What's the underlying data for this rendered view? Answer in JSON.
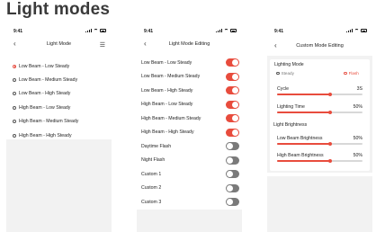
{
  "page_title": "Light modes",
  "status_time": "9:41",
  "screen1": {
    "title": "Light Mode",
    "items": [
      {
        "label": "Low Beam - Low Steady",
        "selected": true
      },
      {
        "label": "Low Beam - Medium Steady",
        "selected": false
      },
      {
        "label": "Low Beam - High Steady",
        "selected": false
      },
      {
        "label": "High Beam - Low Steady",
        "selected": false
      },
      {
        "label": "High Beam - Medium Steady",
        "selected": false
      },
      {
        "label": "High Beam - High Steady",
        "selected": false
      }
    ]
  },
  "screen2": {
    "title": "Light Mode Editing",
    "items": [
      {
        "label": "Low Beam - Low Steady",
        "on": true
      },
      {
        "label": "Low Beam - Medium Steady",
        "on": true
      },
      {
        "label": "Low Beam - High Steady",
        "on": true
      },
      {
        "label": "High Beam - Low Steady",
        "on": true
      },
      {
        "label": "High Beam - Medium Steady",
        "on": true
      },
      {
        "label": "High Beam - High Steady",
        "on": true
      },
      {
        "label": "Daytime Flash",
        "on": false
      },
      {
        "label": "Night Flash",
        "on": false
      },
      {
        "label": "Custom 1",
        "on": false
      },
      {
        "label": "Custom 2",
        "on": false
      },
      {
        "label": "Custom 3",
        "on": false
      }
    ]
  },
  "screen3": {
    "title": "Custom Mode Editing",
    "lighting_mode_label": "Lighting Mode",
    "mode_options": [
      {
        "label": "Steady",
        "selected": false
      },
      {
        "label": "Flash",
        "selected": true
      }
    ],
    "cycle": {
      "label": "Cycle",
      "value_text": "3S",
      "fraction": 0.62
    },
    "lighting_time": {
      "label": "Lighting Time",
      "value_text": "50%",
      "fraction": 0.62
    },
    "brightness_label": "Light Brightness",
    "low_beam": {
      "label": "Low Beam Brightness",
      "value_text": "50%",
      "fraction": 0.62
    },
    "high_beam": {
      "label": "High Beam Brightness",
      "value_text": "50%",
      "fraction": 0.62
    }
  },
  "colors": {
    "accent": "#e84c3d",
    "toggle_off": "#7a7a7a",
    "background": "#f2f2f2"
  }
}
